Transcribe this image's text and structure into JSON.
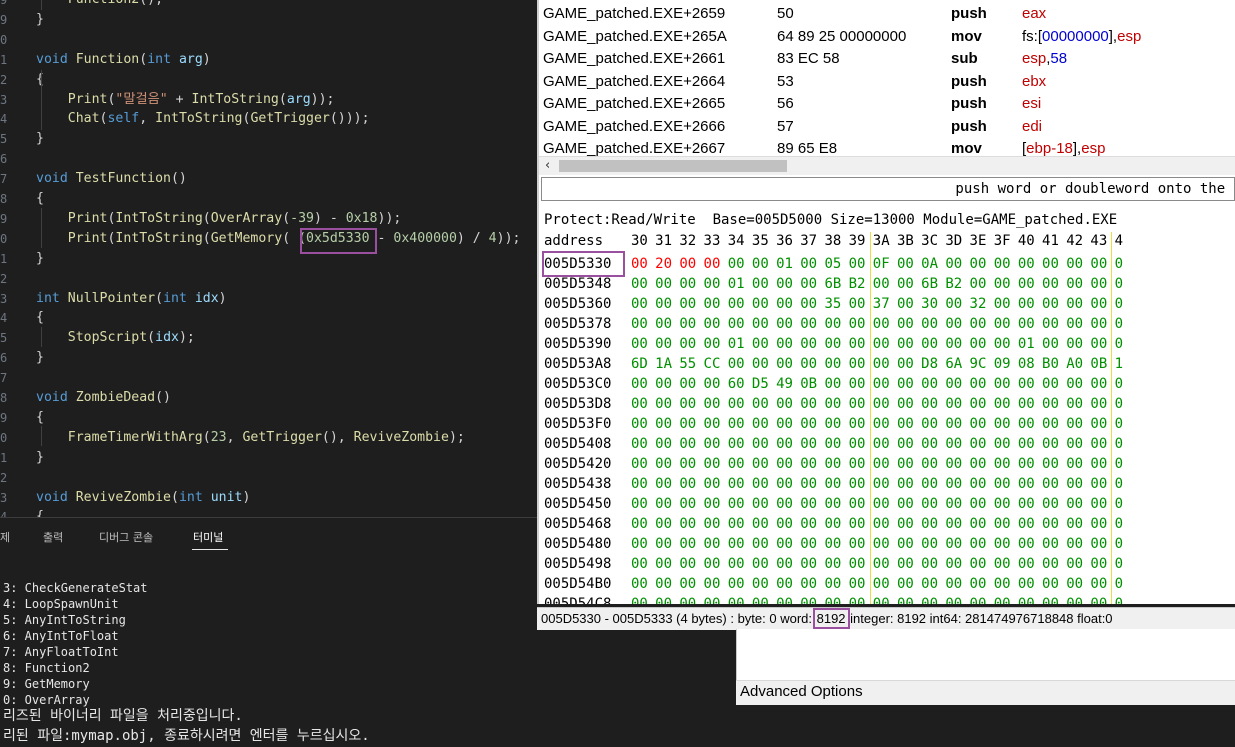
{
  "editor": {
    "lines": [
      {
        "ln": "9",
        "parts": [
          [
            "    ",
            ""
          ],
          [
            "Function2",
            "fn"
          ],
          [
            "();",
            ""
          ]
        ]
      },
      {
        "ln": "9",
        "parts": [
          [
            "}",
            ""
          ]
        ]
      },
      {
        "ln": "0",
        "parts": []
      },
      {
        "ln": "1",
        "parts": [
          [
            "void ",
            "kw"
          ],
          [
            "Function",
            "fn"
          ],
          [
            "(",
            ""
          ],
          [
            "int ",
            "kw"
          ],
          [
            "arg",
            "id"
          ],
          [
            ")",
            ""
          ]
        ]
      },
      {
        "ln": "2",
        "parts": [
          [
            "{",
            ""
          ]
        ]
      },
      {
        "ln": "3",
        "parts": [
          [
            "    ",
            ""
          ],
          [
            "Print",
            "fn"
          ],
          [
            "(",
            ""
          ],
          [
            "\"말걸음\"",
            "str"
          ],
          [
            " + ",
            ""
          ],
          [
            "IntToString",
            "fn"
          ],
          [
            "(",
            ""
          ],
          [
            "arg",
            "id"
          ],
          [
            "));",
            ""
          ]
        ]
      },
      {
        "ln": "4",
        "parts": [
          [
            "    ",
            ""
          ],
          [
            "Chat",
            "fn"
          ],
          [
            "(",
            ""
          ],
          [
            "self",
            "kw"
          ],
          [
            ", ",
            ""
          ],
          [
            "IntToString",
            "fn"
          ],
          [
            "(",
            ""
          ],
          [
            "GetTrigger",
            "fn"
          ],
          [
            "()));",
            ""
          ]
        ]
      },
      {
        "ln": "5",
        "parts": [
          [
            "}",
            ""
          ]
        ]
      },
      {
        "ln": "6",
        "parts": []
      },
      {
        "ln": "7",
        "parts": [
          [
            "void ",
            "kw"
          ],
          [
            "TestFunction",
            "fn"
          ],
          [
            "()",
            ""
          ]
        ]
      },
      {
        "ln": "8",
        "parts": [
          [
            "{",
            ""
          ]
        ]
      },
      {
        "ln": "9",
        "parts": [
          [
            "    ",
            ""
          ],
          [
            "Print",
            "fn"
          ],
          [
            "(",
            ""
          ],
          [
            "IntToString",
            "fn"
          ],
          [
            "(",
            ""
          ],
          [
            "OverArray",
            "fn"
          ],
          [
            "(",
            ""
          ],
          [
            "-39",
            "num"
          ],
          [
            ") - ",
            ""
          ],
          [
            "0x18",
            "num"
          ],
          [
            "));",
            ""
          ]
        ]
      },
      {
        "ln": "0",
        "parts": [
          [
            "    ",
            ""
          ],
          [
            "Print",
            "fn"
          ],
          [
            "(",
            ""
          ],
          [
            "IntToString",
            "fn"
          ],
          [
            "(",
            ""
          ],
          [
            "GetMemory",
            "fn"
          ],
          [
            "( ",
            ""
          ],
          [
            "(0x5d5330",
            "num"
          ],
          [
            " - ",
            ""
          ],
          [
            "0x400000",
            "num"
          ],
          [
            ") / ",
            ""
          ],
          [
            "4",
            "num"
          ],
          [
            "));",
            ""
          ]
        ]
      },
      {
        "ln": "1",
        "parts": [
          [
            "}",
            ""
          ]
        ]
      },
      {
        "ln": "2",
        "parts": []
      },
      {
        "ln": "3",
        "parts": [
          [
            "int ",
            "kw"
          ],
          [
            "NullPointer",
            "fn"
          ],
          [
            "(",
            ""
          ],
          [
            "int ",
            "kw"
          ],
          [
            "idx",
            "id"
          ],
          [
            ")",
            ""
          ]
        ]
      },
      {
        "ln": "4",
        "parts": [
          [
            "{",
            ""
          ]
        ]
      },
      {
        "ln": "5",
        "parts": [
          [
            "    ",
            ""
          ],
          [
            "StopScript",
            "fn"
          ],
          [
            "(",
            ""
          ],
          [
            "idx",
            "id"
          ],
          [
            ");",
            ""
          ]
        ]
      },
      {
        "ln": "6",
        "parts": [
          [
            "}",
            ""
          ]
        ]
      },
      {
        "ln": "7",
        "parts": []
      },
      {
        "ln": "8",
        "parts": [
          [
            "void ",
            "kw"
          ],
          [
            "ZombieDead",
            "fn"
          ],
          [
            "()",
            ""
          ]
        ]
      },
      {
        "ln": "9",
        "parts": [
          [
            "{",
            ""
          ]
        ]
      },
      {
        "ln": "0",
        "parts": [
          [
            "    ",
            ""
          ],
          [
            "FrameTimerWithArg",
            "fn"
          ],
          [
            "(",
            ""
          ],
          [
            "23",
            "num"
          ],
          [
            ", ",
            ""
          ],
          [
            "GetTrigger",
            "fn"
          ],
          [
            "(), ",
            ""
          ],
          [
            "ReviveZombie",
            "fn"
          ],
          [
            ");",
            ""
          ]
        ]
      },
      {
        "ln": "1",
        "parts": [
          [
            "}",
            ""
          ]
        ]
      },
      {
        "ln": "2",
        "parts": []
      },
      {
        "ln": "3",
        "parts": [
          [
            "void ",
            "kw"
          ],
          [
            "ReviveZombie",
            "fn"
          ],
          [
            "(",
            ""
          ],
          [
            "int ",
            "kw"
          ],
          [
            "unit",
            "id"
          ],
          [
            ")",
            ""
          ]
        ]
      },
      {
        "ln": "4",
        "parts": [
          [
            "{",
            ""
          ]
        ]
      }
    ]
  },
  "panel": {
    "tabs": [
      {
        "label": "제",
        "active": false
      },
      {
        "label": "출력",
        "active": false
      },
      {
        "label": "디버그 콘솔",
        "active": false
      },
      {
        "label": "터미널",
        "active": true
      }
    ],
    "terminal_lines": [
      "3: CheckGenerateStat",
      "4: LoopSpawnUnit",
      "5: AnyIntToString",
      "6: AnyIntToFloat",
      "7: AnyFloatToInt",
      "8: Function2",
      "9: GetMemory",
      "0: OverArray",
      "리즈된 바이너리 파일을 처리중입니다.",
      "리된 파일:mymap.obj, 종료하시려면 엔터를 누르십시오."
    ]
  },
  "cheat_engine": {
    "disasm": [
      {
        "addr": "GAME_patched.EXE+2659",
        "bytes": "50",
        "op": "push",
        "args": [
          [
            "eax",
            "red"
          ]
        ]
      },
      {
        "addr": "GAME_patched.EXE+265A",
        "bytes": "64 89 25 00000000",
        "op": "mov",
        "args": [
          [
            "fs:[",
            "black"
          ],
          [
            "00000000",
            "blue"
          ],
          [
            "],",
            "black"
          ],
          [
            "esp",
            "red"
          ]
        ]
      },
      {
        "addr": "GAME_patched.EXE+2661",
        "bytes": "83 EC 58",
        "op": "sub",
        "args": [
          [
            "esp",
            "red"
          ],
          [
            ",",
            "black"
          ],
          [
            "58",
            "blue"
          ]
        ]
      },
      {
        "addr": "GAME_patched.EXE+2664",
        "bytes": "53",
        "op": "push",
        "args": [
          [
            "ebx",
            "red"
          ]
        ]
      },
      {
        "addr": "GAME_patched.EXE+2665",
        "bytes": "56",
        "op": "push",
        "args": [
          [
            "esi",
            "red"
          ]
        ]
      },
      {
        "addr": "GAME_patched.EXE+2666",
        "bytes": "57",
        "op": "push",
        "args": [
          [
            "edi",
            "red"
          ]
        ]
      },
      {
        "addr": "GAME_patched.EXE+2667",
        "bytes": "89 65 E8",
        "op": "mov",
        "args": [
          [
            "[",
            "black"
          ],
          [
            "ebp-18",
            "red"
          ],
          [
            "],",
            "black"
          ],
          [
            "esp",
            "red"
          ]
        ]
      }
    ],
    "description": "push word or doubleword onto the s",
    "hex_info": "Protect:Read/Write  Base=005D5000 Size=13000 Module=GAME_patched.EXE",
    "hex_header_label": "address",
    "hex_columns": [
      "30",
      "31",
      "32",
      "33",
      "34",
      "35",
      "36",
      "37",
      "38",
      "39",
      "3A",
      "3B",
      "3C",
      "3D",
      "3E",
      "3F",
      "40",
      "41",
      "42",
      "43",
      "4"
    ],
    "hex_rows": [
      {
        "addr": "005D5330",
        "bytes": [
          "00",
          "20",
          "00",
          "00",
          "00",
          "00",
          "01",
          "00",
          "05",
          "00",
          "0F",
          "00",
          "0A",
          "00",
          "00",
          "00",
          "00",
          "00",
          "00",
          "00",
          "0"
        ],
        "red": 4
      },
      {
        "addr": "005D5348",
        "bytes": [
          "00",
          "00",
          "00",
          "00",
          "01",
          "00",
          "00",
          "00",
          "6B",
          "B2",
          "00",
          "00",
          "6B",
          "B2",
          "00",
          "00",
          "00",
          "00",
          "00",
          "00",
          "0"
        ],
        "red": 0
      },
      {
        "addr": "005D5360",
        "bytes": [
          "00",
          "00",
          "00",
          "00",
          "00",
          "00",
          "00",
          "00",
          "35",
          "00",
          "37",
          "00",
          "30",
          "00",
          "32",
          "00",
          "00",
          "00",
          "00",
          "00",
          "0"
        ],
        "red": 0
      },
      {
        "addr": "005D5378",
        "bytes": [
          "00",
          "00",
          "00",
          "00",
          "00",
          "00",
          "00",
          "00",
          "00",
          "00",
          "00",
          "00",
          "00",
          "00",
          "00",
          "00",
          "00",
          "00",
          "00",
          "00",
          "0"
        ],
        "red": 0
      },
      {
        "addr": "005D5390",
        "bytes": [
          "00",
          "00",
          "00",
          "00",
          "01",
          "00",
          "00",
          "00",
          "00",
          "00",
          "00",
          "00",
          "00",
          "00",
          "00",
          "00",
          "01",
          "00",
          "00",
          "00",
          "0"
        ],
        "red": 0
      },
      {
        "addr": "005D53A8",
        "bytes": [
          "6D",
          "1A",
          "55",
          "CC",
          "00",
          "00",
          "00",
          "00",
          "00",
          "00",
          "00",
          "00",
          "D8",
          "6A",
          "9C",
          "09",
          "08",
          "B0",
          "A0",
          "0B",
          "1"
        ],
        "red": 0
      },
      {
        "addr": "005D53C0",
        "bytes": [
          "00",
          "00",
          "00",
          "00",
          "60",
          "D5",
          "49",
          "0B",
          "00",
          "00",
          "00",
          "00",
          "00",
          "00",
          "00",
          "00",
          "00",
          "00",
          "00",
          "00",
          "0"
        ],
        "red": 0
      },
      {
        "addr": "005D53D8",
        "bytes": [
          "00",
          "00",
          "00",
          "00",
          "00",
          "00",
          "00",
          "00",
          "00",
          "00",
          "00",
          "00",
          "00",
          "00",
          "00",
          "00",
          "00",
          "00",
          "00",
          "00",
          "0"
        ],
        "red": 0
      },
      {
        "addr": "005D53F0",
        "bytes": [
          "00",
          "00",
          "00",
          "00",
          "00",
          "00",
          "00",
          "00",
          "00",
          "00",
          "00",
          "00",
          "00",
          "00",
          "00",
          "00",
          "00",
          "00",
          "00",
          "00",
          "0"
        ],
        "red": 0
      },
      {
        "addr": "005D5408",
        "bytes": [
          "00",
          "00",
          "00",
          "00",
          "00",
          "00",
          "00",
          "00",
          "00",
          "00",
          "00",
          "00",
          "00",
          "00",
          "00",
          "00",
          "00",
          "00",
          "00",
          "00",
          "0"
        ],
        "red": 0
      },
      {
        "addr": "005D5420",
        "bytes": [
          "00",
          "00",
          "00",
          "00",
          "00",
          "00",
          "00",
          "00",
          "00",
          "00",
          "00",
          "00",
          "00",
          "00",
          "00",
          "00",
          "00",
          "00",
          "00",
          "00",
          "0"
        ],
        "red": 0
      },
      {
        "addr": "005D5438",
        "bytes": [
          "00",
          "00",
          "00",
          "00",
          "00",
          "00",
          "00",
          "00",
          "00",
          "00",
          "00",
          "00",
          "00",
          "00",
          "00",
          "00",
          "00",
          "00",
          "00",
          "00",
          "0"
        ],
        "red": 0
      },
      {
        "addr": "005D5450",
        "bytes": [
          "00",
          "00",
          "00",
          "00",
          "00",
          "00",
          "00",
          "00",
          "00",
          "00",
          "00",
          "00",
          "00",
          "00",
          "00",
          "00",
          "00",
          "00",
          "00",
          "00",
          "0"
        ],
        "red": 0
      },
      {
        "addr": "005D5468",
        "bytes": [
          "00",
          "00",
          "00",
          "00",
          "00",
          "00",
          "00",
          "00",
          "00",
          "00",
          "00",
          "00",
          "00",
          "00",
          "00",
          "00",
          "00",
          "00",
          "00",
          "00",
          "0"
        ],
        "red": 0
      },
      {
        "addr": "005D5480",
        "bytes": [
          "00",
          "00",
          "00",
          "00",
          "00",
          "00",
          "00",
          "00",
          "00",
          "00",
          "00",
          "00",
          "00",
          "00",
          "00",
          "00",
          "00",
          "00",
          "00",
          "00",
          "0"
        ],
        "red": 0
      },
      {
        "addr": "005D5498",
        "bytes": [
          "00",
          "00",
          "00",
          "00",
          "00",
          "00",
          "00",
          "00",
          "00",
          "00",
          "00",
          "00",
          "00",
          "00",
          "00",
          "00",
          "00",
          "00",
          "00",
          "00",
          "0"
        ],
        "red": 0
      },
      {
        "addr": "005D54B0",
        "bytes": [
          "00",
          "00",
          "00",
          "00",
          "00",
          "00",
          "00",
          "00",
          "00",
          "00",
          "00",
          "00",
          "00",
          "00",
          "00",
          "00",
          "00",
          "00",
          "00",
          "00",
          "0"
        ],
        "red": 0
      },
      {
        "addr": "005D54C8",
        "bytes": [
          "00",
          "00",
          "00",
          "00",
          "00",
          "00",
          "00",
          "00",
          "00",
          "00",
          "00",
          "00",
          "00",
          "00",
          "00",
          "00",
          "00",
          "00",
          "00",
          "00",
          "0"
        ],
        "red": 0
      }
    ],
    "status": {
      "prefix": "005D5330 - 005D5333 (4 bytes) : byte: 0 word: ",
      "word_value": "8192",
      "suffix": " integer: 8192 int64: 281474976718848 float:0"
    },
    "advanced_options": "Advanced Options"
  },
  "colors": {
    "highlight": "#9b4f9f",
    "hex_value": "#009000",
    "hex_changed": "#ff0000",
    "separator": "#e8e040"
  }
}
